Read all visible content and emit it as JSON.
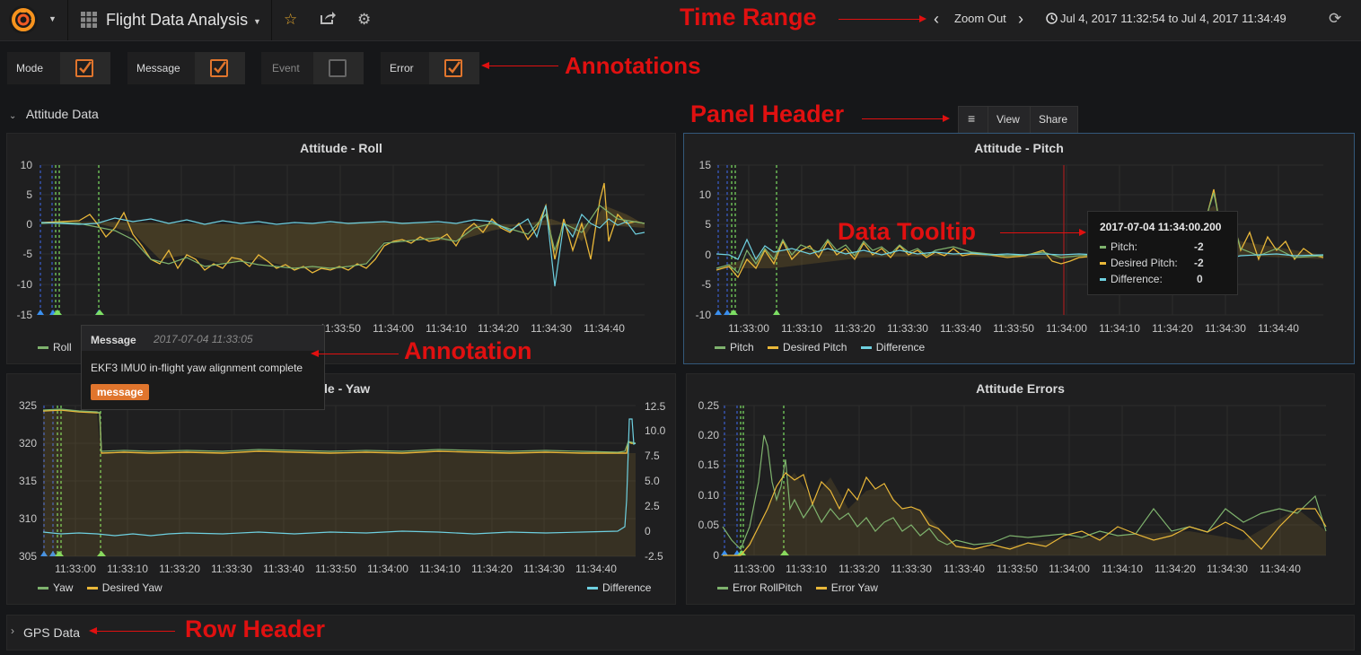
{
  "navbar": {
    "dashboard_title": "Flight Data Analysis",
    "zoom_out": "Zoom Out",
    "time_range": "Jul 4, 2017 11:32:54 to Jul 4, 2017 11:34:49"
  },
  "annotation_toggles": [
    {
      "label": "Mode",
      "checked": true
    },
    {
      "label": "Message",
      "checked": true
    },
    {
      "label": "Event",
      "checked": false
    },
    {
      "label": "Error",
      "checked": true
    }
  ],
  "callouts": {
    "time_range": "Time Range",
    "annotations": "Annotations",
    "panel_header": "Panel Header",
    "data_tooltip": "Data Tooltip",
    "annotation": "Annotation",
    "row_header": "Row Header"
  },
  "rows": {
    "attitude": "Attitude Data",
    "gps": "GPS Data"
  },
  "panel_menu": {
    "view": "View",
    "share": "Share"
  },
  "colors": {
    "green": "#7eb26d",
    "yellow": "#eab839",
    "cyan": "#6ed0e0",
    "orange": "#e0752d",
    "accent_blue": "#33587a"
  },
  "x_ticks": [
    "11:33:00",
    "11:33:10",
    "11:33:20",
    "11:33:30",
    "11:33:40",
    "11:33:50",
    "11:34:00",
    "11:34:10",
    "11:34:20",
    "11:34:30",
    "11:34:40"
  ],
  "panels": {
    "roll": {
      "title": "Attitude - Roll",
      "y_ticks": [
        "10",
        "5",
        "0",
        "-5",
        "-10",
        "-15"
      ],
      "x_ticks_visible": [
        "11:33:50",
        "11:34:00",
        "11:34:10",
        "11:34:20",
        "11:34:30",
        "11:34:40"
      ],
      "legend": [
        "Roll"
      ]
    },
    "pitch": {
      "title": "Attitude - Pitch",
      "y_ticks": [
        "15",
        "10",
        "5",
        "0",
        "-5",
        "-10"
      ],
      "legend": [
        "Pitch",
        "Desired Pitch",
        "Difference"
      ]
    },
    "yaw": {
      "title": "ude - Yaw",
      "y_ticks": [
        "325",
        "320",
        "315",
        "310",
        "305"
      ],
      "y2_ticks": [
        "12.5",
        "10.0",
        "7.5",
        "5.0",
        "2.5",
        "0",
        "-2.5"
      ],
      "legend": [
        "Yaw",
        "Desired Yaw"
      ],
      "legend_right": [
        "Difference"
      ]
    },
    "errors": {
      "title": "Attitude Errors",
      "y_ticks": [
        "0.25",
        "0.20",
        "0.15",
        "0.10",
        "0.05",
        "0"
      ],
      "legend": [
        "Error RollPitch",
        "Error Yaw"
      ]
    }
  },
  "annotation_popup": {
    "type": "Message",
    "time": "2017-07-04 11:33:05",
    "text": "EKF3 IMU0 in-flight yaw alignment complete",
    "tag": "message"
  },
  "data_tooltip": {
    "time": "2017-07-04 11:34:00.200",
    "rows": [
      {
        "label": "Pitch:",
        "value": "-2"
      },
      {
        "label": "Desired Pitch:",
        "value": "-2"
      },
      {
        "label": "Difference:",
        "value": "0"
      }
    ]
  }
}
